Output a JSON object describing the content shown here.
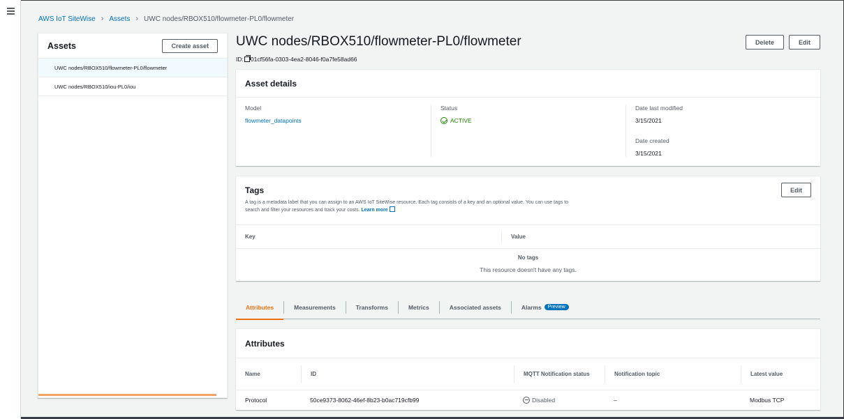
{
  "breadcrumb": {
    "items": [
      "AWS IoT SiteWise",
      "Assets"
    ],
    "current": "UWC nodes/RBOX510/flowmeter-PL0/flowmeter"
  },
  "left_panel": {
    "title": "Assets",
    "create_button": "Create asset",
    "assets": [
      "UWC nodes/RBOX510/flowmeter-PL0/flowmeter",
      "UWC nodes/RBOX510/iou-PL0/iou"
    ]
  },
  "header": {
    "title": "UWC nodes/RBOX510/flowmeter-PL0/flowmeter",
    "id_label": "ID:",
    "id_value": "01cf56fa-0303-4ea2-8046-f0a7fe58ad66",
    "delete_button": "Delete",
    "edit_button": "Edit"
  },
  "asset_details": {
    "title": "Asset details",
    "model_label": "Model",
    "model_value": "flowmeter_datapoints",
    "status_label": "Status",
    "status_value": "ACTIVE",
    "modified_label": "Date last modified",
    "modified_value": "3/15/2021",
    "created_label": "Date created",
    "created_value": "3/15/2021"
  },
  "tags": {
    "title": "Tags",
    "edit_button": "Edit",
    "description_line1": "A tag is a metadata label that you can assign to an AWS IoT SiteWise resource. Each tag consists of a key and an optional value. You can use tags to",
    "description_line2": "search and filter your resources and track your costs.",
    "learn_more": "Learn more",
    "col_key": "Key",
    "col_value": "Value",
    "empty_title": "No tags",
    "empty_desc": "This resource doesn't have any tags."
  },
  "tabs": [
    {
      "label": "Attributes",
      "active": true
    },
    {
      "label": "Measurements"
    },
    {
      "label": "Transforms"
    },
    {
      "label": "Metrics"
    },
    {
      "label": "Associated assets"
    },
    {
      "label": "Alarms",
      "badge": "Preview"
    }
  ],
  "attributes": {
    "title": "Attributes",
    "columns": [
      "Name",
      "ID",
      "MQTT Notification status",
      "Notification topic",
      "Latest value"
    ],
    "rows": [
      {
        "name": "Protocol",
        "id": "50ce9373-8062-46ef-8b23-b0ac719cfb99",
        "mqtt_status": "Disabled",
        "topic": "–",
        "latest": "Modbus TCP"
      }
    ]
  },
  "colors": {
    "accent": "#ec7211",
    "link": "#0073bb",
    "success": "#1d8102"
  },
  "icons": [
    "menu-icon",
    "chevron-right-icon",
    "copy-icon",
    "check-circle-icon",
    "external-link-icon",
    "disabled-circle-icon"
  ]
}
